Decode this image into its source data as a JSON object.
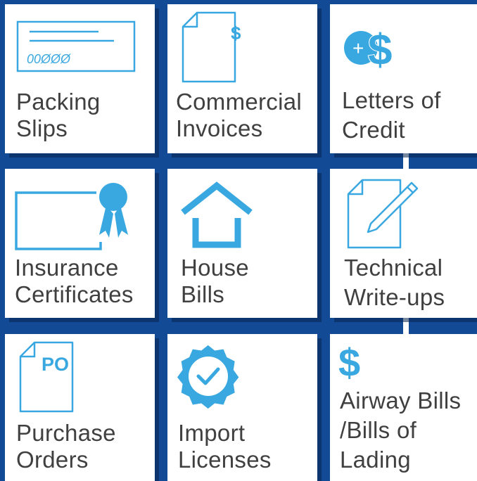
{
  "colors": {
    "background": "#124a96",
    "tile": "#ffffff",
    "icon": "#3aa8e0",
    "text": "#404040"
  },
  "tiles": [
    {
      "icon": "check-icon",
      "lines": [
        "Packing",
        "Slips"
      ],
      "check_digits": "00ØØØ"
    },
    {
      "icon": "invoice-icon",
      "lines": [
        "Commercial",
        "Invoices"
      ],
      "currency": "$"
    },
    {
      "icon": "add-dollar-icon",
      "lines": [
        "Letters of",
        "Credit"
      ],
      "plus": "+",
      "currency": "$"
    },
    {
      "icon": "certificate-icon",
      "lines": [
        "Insurance",
        "Certificates"
      ]
    },
    {
      "icon": "house-icon",
      "lines": [
        "House",
        "Bills"
      ]
    },
    {
      "icon": "pencil-icon",
      "lines": [
        "Technical",
        "Write-ups"
      ]
    },
    {
      "icon": "po-document-icon",
      "lines": [
        "Purchase",
        "Orders"
      ],
      "badge": "PO"
    },
    {
      "icon": "verified-badge-icon",
      "lines": [
        "Import",
        "Licenses"
      ]
    },
    {
      "icon": "dollar-icon",
      "lines": [
        "Airway Bills",
        "/Bills of",
        "Lading"
      ],
      "currency": "$"
    }
  ]
}
